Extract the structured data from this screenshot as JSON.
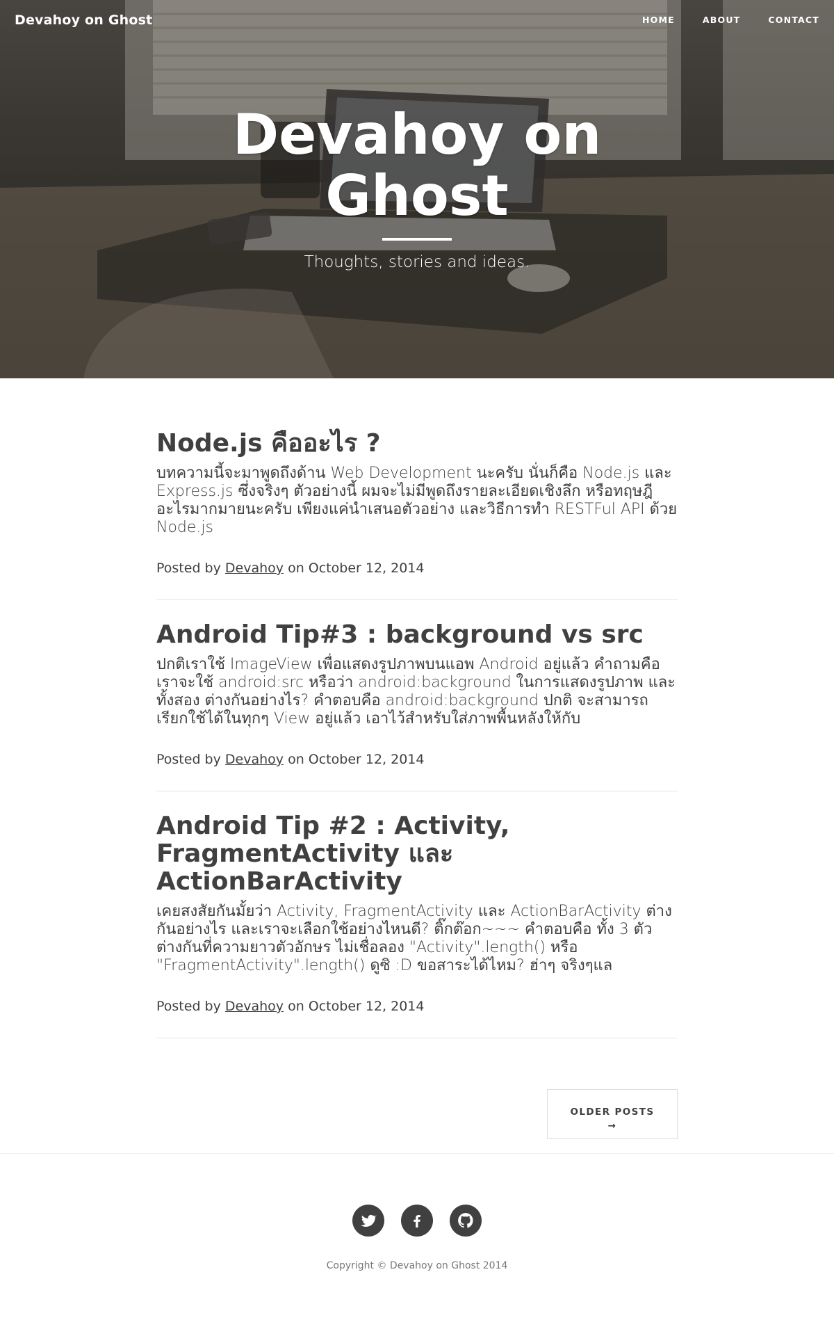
{
  "nav": {
    "brand": "Devahoy on Ghost",
    "links": [
      "HOME",
      "ABOUT",
      "CONTACT"
    ]
  },
  "hero": {
    "title": "Devahoy on Ghost",
    "subtitle": "Thoughts, stories and ideas."
  },
  "posts": [
    {
      "title": "Node.js คืออะไร ?",
      "excerpt": "บทความนี้จะมาพูดถึงด้าน Web Development นะครับ นั่นก็คือ Node.js และ Express.js ซึ่งจริงๆ ตัวอย่างนี้ ผมจะไม่มีพูดถึงรายละเอียดเชิงลึก หรือทฤษฎีอะไรมากมายนะครับ เพียงแค่นำเสนอตัวอย่าง และวิธีการทำ RESTFul API ด้วย Node.js",
      "meta_prefix": "Posted by",
      "author": "Devahoy",
      "meta_suffix": "on October 12, 2014"
    },
    {
      "title": "Android Tip#3 : background vs src",
      "excerpt": "ปกติเราใช้ ImageView เพื่อแสดงรูปภาพบนแอพ Android อยู่แล้ว คำถามคือ เราจะใช้ android:src หรือว่า android:background ในการแสดงรูปภาพ และทั้งสอง ต่างกันอย่างไร? คำตอบคือ android:background ปกติ จะสามารถเรียกใช้ได้ในทุกๆ View อยู่แล้ว เอาไว้สำหรับใส่ภาพพื้นหลังให้กับ",
      "meta_prefix": "Posted by",
      "author": "Devahoy",
      "meta_suffix": "on October 12, 2014"
    },
    {
      "title": "Android Tip #2 : Activity, FragmentActivity และ ActionBarActivity",
      "excerpt": "เคยสงสัยกันมั้ยว่า Activity, FragmentActivity และ ActionBarActivity ต่างกันอย่างไร และเราจะเลือกใช้อย่างไหนดี? ติ๊กต๊อก~~~ คำตอบคือ ทั้ง 3 ตัวต่างกันที่ความยาวตัวอักษร ไม่เชื่อลอง \"Activity\".length() หรือ \"FragmentActivity\".length() ดูซิ :D ขอสาระได้ไหม? ฮ่าๆ จริงๆแล",
      "meta_prefix": "Posted by",
      "author": "Devahoy",
      "meta_suffix": "on October 12, 2014"
    }
  ],
  "pager": {
    "older_label": "OLDER POSTS",
    "older_arrow": "→"
  },
  "footer": {
    "social": [
      "twitter-icon",
      "facebook-icon",
      "github-icon"
    ],
    "copyright": "Copyright © Devahoy on Ghost 2014"
  }
}
